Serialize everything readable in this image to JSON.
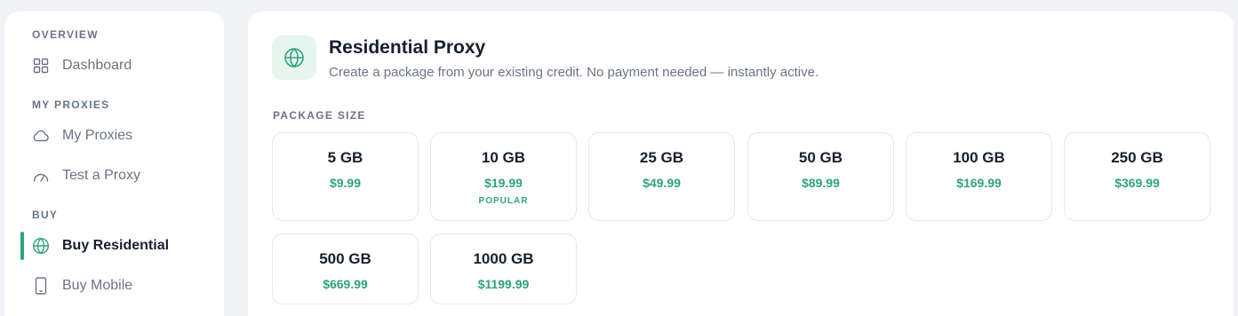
{
  "sidebar": {
    "sections": [
      {
        "label": "OVERVIEW"
      },
      {
        "label": "MY PROXIES"
      },
      {
        "label": "BUY"
      }
    ],
    "items": [
      {
        "label": "Dashboard",
        "icon": "grid-icon"
      },
      {
        "label": "My Proxies",
        "icon": "cloud-icon"
      },
      {
        "label": "Test a Proxy",
        "icon": "gauge-icon"
      },
      {
        "label": "Buy Residential",
        "icon": "globe-icon",
        "active": true
      },
      {
        "label": "Buy Mobile",
        "icon": "phone-icon"
      }
    ]
  },
  "main": {
    "title": "Residential Proxy",
    "subtitle": "Create a package from your existing credit. No payment needed — instantly active.",
    "package_size_label": "PACKAGE SIZE",
    "packages": [
      {
        "size": "5 GB",
        "price": "$9.99",
        "badge": ""
      },
      {
        "size": "10 GB",
        "price": "$19.99",
        "badge": "POPULAR"
      },
      {
        "size": "25 GB",
        "price": "$49.99",
        "badge": ""
      },
      {
        "size": "50 GB",
        "price": "$89.99",
        "badge": ""
      },
      {
        "size": "100 GB",
        "price": "$169.99",
        "badge": ""
      },
      {
        "size": "250 GB",
        "price": "$369.99",
        "badge": ""
      },
      {
        "size": "500 GB",
        "price": "$669.99",
        "badge": ""
      },
      {
        "size": "1000 GB",
        "price": "$1199.99",
        "badge": ""
      }
    ]
  },
  "colors": {
    "accent": "#2fa37b",
    "accent_bg": "#e6f5ee",
    "text_dark": "#16202e",
    "text_muted": "#6b7483",
    "page_bg": "#f1f2f5"
  }
}
